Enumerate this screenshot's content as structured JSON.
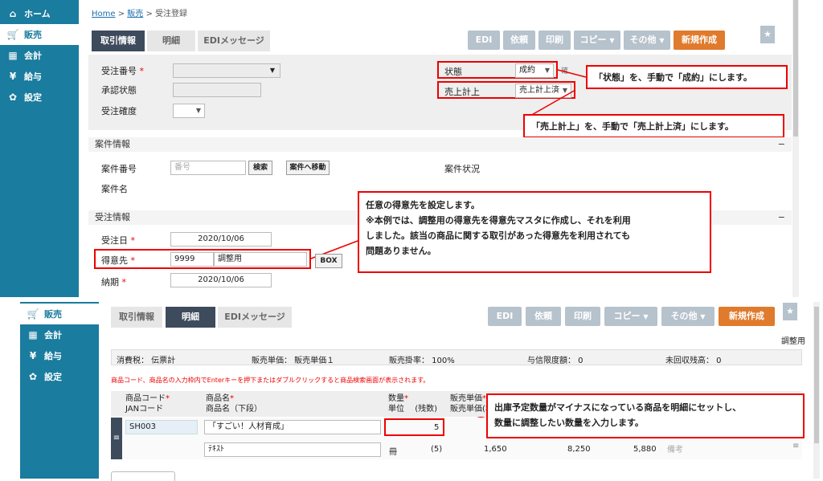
{
  "top": {
    "sidebar": [
      {
        "icon": "home-icon",
        "glyph": "⌂",
        "label": "ホーム"
      },
      {
        "icon": "cart-icon",
        "glyph": "🛒",
        "label": "販売"
      },
      {
        "icon": "calculator-icon",
        "glyph": "▦",
        "label": "会計"
      },
      {
        "icon": "moneybag-icon",
        "glyph": "¥",
        "label": "給与"
      },
      {
        "icon": "gear-icon",
        "glyph": "✿",
        "label": "設定"
      }
    ],
    "breadcrumb": {
      "home": "Home",
      "sales": "販売",
      "current": "受注登録",
      "sep": ">"
    },
    "tabs": [
      "取引情報",
      "明細",
      "EDIメッセージ"
    ],
    "toolbar": {
      "edi": "EDI",
      "request": "依頼",
      "print": "印刷",
      "copy": "コピー",
      "other": "その他",
      "new": "新規作成"
    },
    "form": {
      "order_no": "受注番号",
      "approval": "承認状態",
      "accuracy": "受注確度",
      "status": "状態",
      "status_value": "成約",
      "status_trail": "確",
      "sales": "売上計上",
      "sales_value": "売上計上済"
    },
    "callouts": {
      "status": "「状態」を、手動で「成約」にします。",
      "sales": "「売上計上」を、手動で「売上計上済」にします。",
      "customer": [
        "任意の得意先を設定します。",
        "※本例では、調整用の得意先を得意先マスタに作成し、それを利用",
        "しました。該当の商品に関する取引があった得意先を利用されても",
        "問題ありません。"
      ]
    },
    "project": {
      "header": "案件情報",
      "minus": "−",
      "no": "案件番号",
      "no_placeholder": "番号",
      "search": "検索",
      "move": "案件へ移動",
      "status": "案件状況",
      "name": "案件名"
    },
    "order": {
      "header": "受注情報",
      "minus": "−",
      "date": "受注日",
      "date_value": "2020/10/06",
      "customer": "得意先",
      "customer_code": "9999",
      "customer_name": "調整用",
      "customer_btn": "BOX",
      "delivery": "納期",
      "delivery_value": "2020/10/06"
    }
  },
  "bottom": {
    "sidebar": [
      {
        "icon": "cart-icon",
        "glyph": "🛒",
        "label": "販売"
      },
      {
        "icon": "calculator-icon",
        "glyph": "▦",
        "label": "会計"
      },
      {
        "icon": "moneybag-icon",
        "glyph": "¥",
        "label": "給与"
      },
      {
        "icon": "gear-icon",
        "glyph": "✿",
        "label": "設定"
      }
    ],
    "tabs": [
      "取引情報",
      "明細",
      "EDIメッセージ"
    ],
    "toolbar": {
      "edi": "EDI",
      "request": "依頼",
      "print": "印刷",
      "copy": "コピー",
      "other": "その他",
      "new": "新規作成"
    },
    "customer_tag": "調整用",
    "info": {
      "tax": "消費税： 伝票計",
      "unit": "販売単価： 販売単価１",
      "rate": "販売掛率： 100%",
      "credit": "与信限度額： 0",
      "unpaid": "未回収残高： 0"
    },
    "hint": "商品コード、商品名の入力枠内でEnterキーを押下またはダブルクリックすると商品検索画面が表示されます。",
    "columns": {
      "code": "商品コード",
      "jan": "JANコード",
      "name": "商品名",
      "name2": "商品名（下段）",
      "qty": "数量",
      "unit": "単位",
      "remain": "(残数)",
      "price": "販売単価",
      "price2": "販売単価(本"
    },
    "row": {
      "code": "SH003",
      "name": "「すごい！人材育成」",
      "qty": "5",
      "unit_text": "ﾃｷｽﾄ",
      "unit": "冊",
      "remain": "(5)",
      "v1": "1,650",
      "v2": "8,250",
      "v3": "5,880",
      "memo": "備考"
    },
    "callout": [
      "出庫予定数量がマイナスになっている商品を明細にセットし、",
      "数量に調整したい数量を入力します。"
    ]
  }
}
